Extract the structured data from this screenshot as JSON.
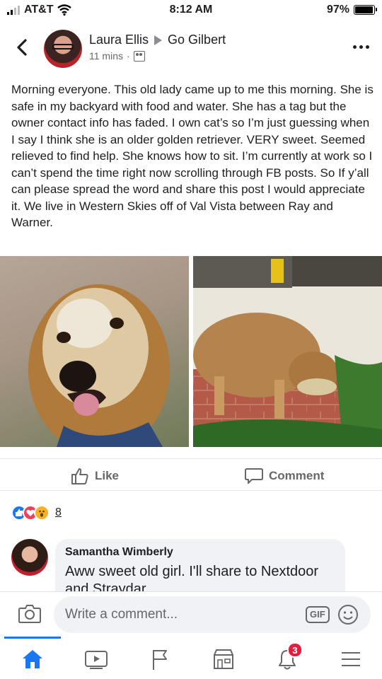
{
  "status_bar": {
    "carrier": "AT&T",
    "time": "8:12 AM",
    "battery": "97%",
    "battery_level": 0.97
  },
  "header": {
    "author": "Laura Ellis",
    "group": "Go Gilbert",
    "time_ago": "11 mins",
    "separator": "·"
  },
  "post": {
    "text": "Morning everyone.  This old lady came up to me this morning.  She is safe in my backyard with food and water.  She has a tag but the owner contact info has faded.  I own cat’s so I’m just guessing when I say I think she is an older golden retriever.  VERY sweet.  Seemed relieved to find help.  She knows how to sit.   I’m currently at work so I can’t spend the time right now scrolling through FB posts.  So If y’all can please spread the word and share this post I would appreciate it.  We live in Western Skies off of Val Vista between Ray and Warner."
  },
  "actions": {
    "like": "Like",
    "comment": "Comment"
  },
  "reactions": {
    "icons": [
      "like-reaction",
      "love-reaction",
      "wow-reaction"
    ],
    "count": "8"
  },
  "comment": {
    "author": "Samantha Wimberly",
    "text": "Aww sweet old girl. I'll share to Nextdoor and Straydar"
  },
  "composer": {
    "placeholder": "Write a comment...",
    "gif": "GIF"
  },
  "tabbar": {
    "tabs": [
      "home-icon",
      "watch-icon",
      "pages-icon",
      "marketplace-icon",
      "notifications-icon",
      "menu-icon"
    ],
    "active": "home",
    "notifications_badge": "3"
  },
  "colors": {
    "accent": "#1877f2",
    "secondary_text": "#65676b",
    "badge": "#e41e3f"
  }
}
